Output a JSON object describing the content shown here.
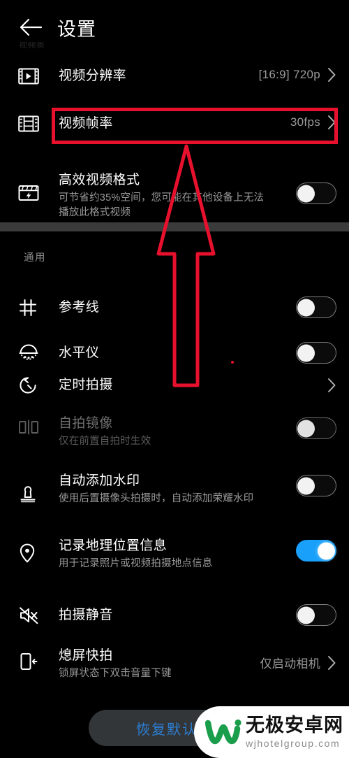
{
  "header": {
    "back_icon": "back-arrow-icon",
    "title": "设置",
    "ghost_label": "视频类"
  },
  "sections": [
    {
      "id": "video",
      "label": "",
      "rows": [
        {
          "id": "video-resolution",
          "icon": "film-play-icon",
          "title": "视频分辨率",
          "sub": "",
          "control": "value",
          "value": "[16:9] 720p"
        },
        {
          "id": "video-framerate",
          "icon": "film-grid-icon",
          "title": "视频帧率",
          "sub": "",
          "control": "value",
          "value": "30fps",
          "highlighted": true
        },
        {
          "id": "efficient-video-format",
          "icon": "clapperboard-bolt-icon",
          "title": "高效视频格式",
          "sub": "可节省约35%空间，您可能在其他设备上无法播放此格式视频",
          "control": "toggle",
          "value": "off"
        }
      ]
    },
    {
      "id": "general",
      "label": "通用",
      "rows": [
        {
          "id": "grid-lines",
          "icon": "grid-hash-icon",
          "title": "参考线",
          "sub": "",
          "control": "toggle",
          "value": "off"
        },
        {
          "id": "level-gauge",
          "icon": "level-bubble-icon",
          "title": "水平仪",
          "sub": "",
          "control": "toggle",
          "value": "off"
        },
        {
          "id": "timer-shot",
          "icon": "timer-icon",
          "title": "定时拍摄",
          "sub": "",
          "control": "chevron",
          "value": ""
        },
        {
          "id": "selfie-mirror",
          "icon": "mirror-icon",
          "title": "自拍镜像",
          "sub": "仅在前置自拍时生效",
          "control": "toggle",
          "value": "off",
          "disabled": true
        },
        {
          "id": "auto-watermark",
          "icon": "stamp-icon",
          "title": "自动添加水印",
          "sub": "使用后置摄像头拍摄时，自动添加荣耀水印",
          "control": "toggle",
          "value": "off"
        },
        {
          "id": "record-location",
          "icon": "location-pin-icon",
          "title": "记录地理位置信息",
          "sub": "用于记录照片或视频拍摄地点信息",
          "control": "toggle",
          "value": "on"
        },
        {
          "id": "silent-capture",
          "icon": "mute-speaker-icon",
          "title": "拍摄静音",
          "sub": "",
          "control": "toggle",
          "value": "off"
        },
        {
          "id": "screen-off-snap",
          "icon": "phone-side-icon",
          "title": "熄屏快拍",
          "sub": "锁屏状态下双击音量下键",
          "control": "value",
          "value": "仅启动相机"
        }
      ]
    }
  ],
  "restore_button": {
    "label": "恢复默认值"
  },
  "annotation": {
    "box_target": "视频帧率",
    "arrow": "up-arrow-annotation",
    "color": "#e8112d"
  },
  "watermark": {
    "logo": "w-logo-icon",
    "title": "无极安卓网",
    "url": "wjhotelgroup.com",
    "logo_color": "#1a9e4b"
  },
  "colors": {
    "background": "#000000",
    "accent_toggle_on": "#18a0fb",
    "restore_text": "#2b7fd4",
    "annotation_red": "#e8112d",
    "subtitle_grey": "#9a9a9a",
    "divider": "#3b3b3b"
  }
}
